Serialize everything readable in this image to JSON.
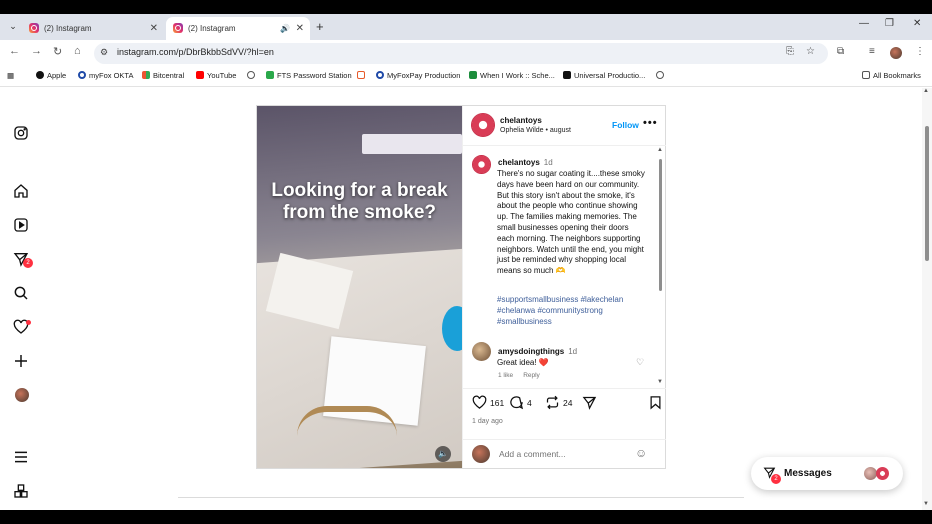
{
  "browser": {
    "tabs": [
      {
        "title": "(2) Instagram"
      },
      {
        "title": "(2) Instagram"
      }
    ],
    "url": "instagram.com/p/DbrBkbbSdVV/?hl=en",
    "bookmarks": [
      {
        "label": "Apple",
        "icon": "apple-icon"
      },
      {
        "label": "myFox OKTA",
        "icon": "circle-icon"
      },
      {
        "label": "Bitcentral",
        "icon": "grid-icon"
      },
      {
        "label": "YouTube",
        "icon": "youtube-icon"
      },
      {
        "label": "",
        "icon": "globe-icon"
      },
      {
        "label": "FTS Password Station",
        "icon": "key-icon"
      },
      {
        "label": "",
        "icon": "brackets-icon"
      },
      {
        "label": "MyFoxPay Production",
        "icon": "circle-icon"
      },
      {
        "label": "When I Work :: Sche...",
        "icon": "calendar-icon"
      },
      {
        "label": "Universal Productio...",
        "icon": "square-icon"
      },
      {
        "label": "",
        "icon": "globe-icon"
      }
    ],
    "all_bookmarks": "All Bookmarks"
  },
  "sidebar": {
    "notification_count": "2"
  },
  "post": {
    "video_caption": "Looking for a break from the smoke?",
    "header": {
      "username": "chelantoys",
      "subtitle": "Ophelia Wilde • august",
      "follow_label": "Follow",
      "more": "•••"
    },
    "caption": {
      "username": "chelantoys",
      "time": "1d",
      "text": "There's no sugar coating it....these smoky days have been hard on our community. But this story isn't about the smoke, it's about the people who continue showing up. The families making memories. The small businesses opening their doors each morning. The neighbors supporting neighbors. Watch until the end, you might just be reminded why shopping local means so much 🫶",
      "hashtags": "#supportsmallbusiness #lakechelan #chelanwa #communitystrong #smallbusiness"
    },
    "comment": {
      "username": "amysdoingthings",
      "time": "1d",
      "text": "Great idea! ❤️",
      "likes": "1 like",
      "reply": "Reply"
    },
    "stats": {
      "likes": "161",
      "comments": "4",
      "reposts": "24"
    },
    "posted": "1 day ago",
    "add_comment_placeholder": "Add a comment..."
  },
  "messages": {
    "label": "Messages",
    "badge": "2"
  },
  "colors": {
    "accent": "#0095f6",
    "hashtag": "#3f5f9a",
    "badge": "#ff3040"
  }
}
